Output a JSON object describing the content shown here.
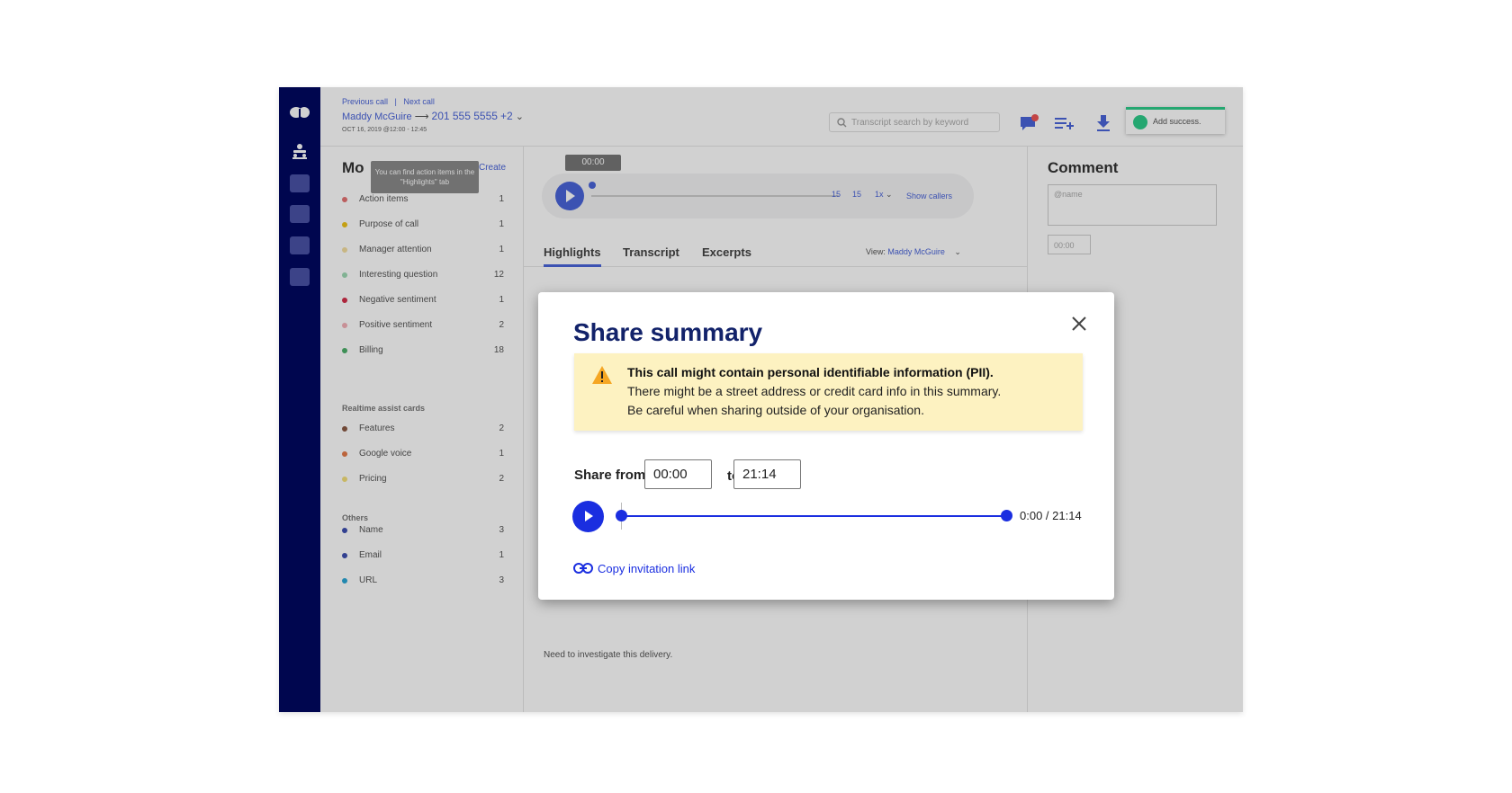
{
  "header": {
    "previous_call": "Previous call",
    "separator": "|",
    "next_call": "Next call",
    "caller_name": "Maddy McGuire",
    "caller_number": "201 555 5555",
    "extra_participants": "+2",
    "call_date": "OCT 16, 2019 @12:00 - 12:45",
    "search_placeholder": "Transcript search by keyword",
    "toast_text": "Add success."
  },
  "moments": {
    "title": "Mo",
    "create_label": "Create",
    "tooltip": "You can find action items in the \"Highlights\" tab",
    "items": [
      {
        "label": "Action items",
        "count": "1",
        "color": "#e57373"
      },
      {
        "label": "Purpose of call",
        "count": "1",
        "color": "#f0c419"
      },
      {
        "label": "Manager attention",
        "count": "1",
        "color": "#f5dfa0"
      },
      {
        "label": "Interesting question",
        "count": "12",
        "color": "#9ed9b4"
      },
      {
        "label": "Negative sentiment",
        "count": "1",
        "color": "#d32f4a"
      },
      {
        "label": "Positive sentiment",
        "count": "2",
        "color": "#f3b0b8"
      },
      {
        "label": "Billing",
        "count": "18",
        "color": "#4caf6a"
      }
    ],
    "realtime_label": "Realtime assist cards",
    "realtime_items": [
      {
        "label": "Features",
        "count": "2",
        "color": "#8a5a44"
      },
      {
        "label": "Google voice",
        "count": "1",
        "color": "#e57a4a"
      },
      {
        "label": "Pricing",
        "count": "2",
        "color": "#f5e07a"
      }
    ],
    "others_label": "Others",
    "other_items": [
      {
        "label": "Name",
        "count": "3",
        "color": "#3d4fb0"
      },
      {
        "label": "Email",
        "count": "1",
        "color": "#3d4fb0"
      },
      {
        "label": "URL",
        "count": "3",
        "color": "#2aa6d6"
      }
    ]
  },
  "player": {
    "time_pill": "00:00",
    "skip_back": "15",
    "skip_forward": "15",
    "speed": "1x",
    "show_callers": "Show callers"
  },
  "tabs": {
    "highlights": "Highlights",
    "transcript": "Transcript",
    "excerpts": "Excerpts",
    "view_label": "View:",
    "view_value": "Maddy McGuire"
  },
  "behind_text": "Need to investigate this delivery.",
  "comment": {
    "title": "Comment",
    "placeholder": "@name",
    "time": "00:00"
  },
  "modal": {
    "title": "Share summary",
    "warning_title": "This call might contain personal identifiable information (PII).",
    "warning_line1": "There might be a street address or credit card info in this summary.",
    "warning_line2": "Be careful when sharing outside of your organisation.",
    "share_from_label": "Share from",
    "from_value": "00:00",
    "to_label": "to",
    "to_value": "21:14",
    "time_display": "0:00 / 21:14",
    "copy_link_label": "Copy invitation link"
  },
  "colors": {
    "rail": "#000861",
    "accent": "#1a2ee0",
    "modal_title": "#12226a",
    "warning_bg": "#fdf2c1",
    "warning_icon": "#f5a623"
  }
}
